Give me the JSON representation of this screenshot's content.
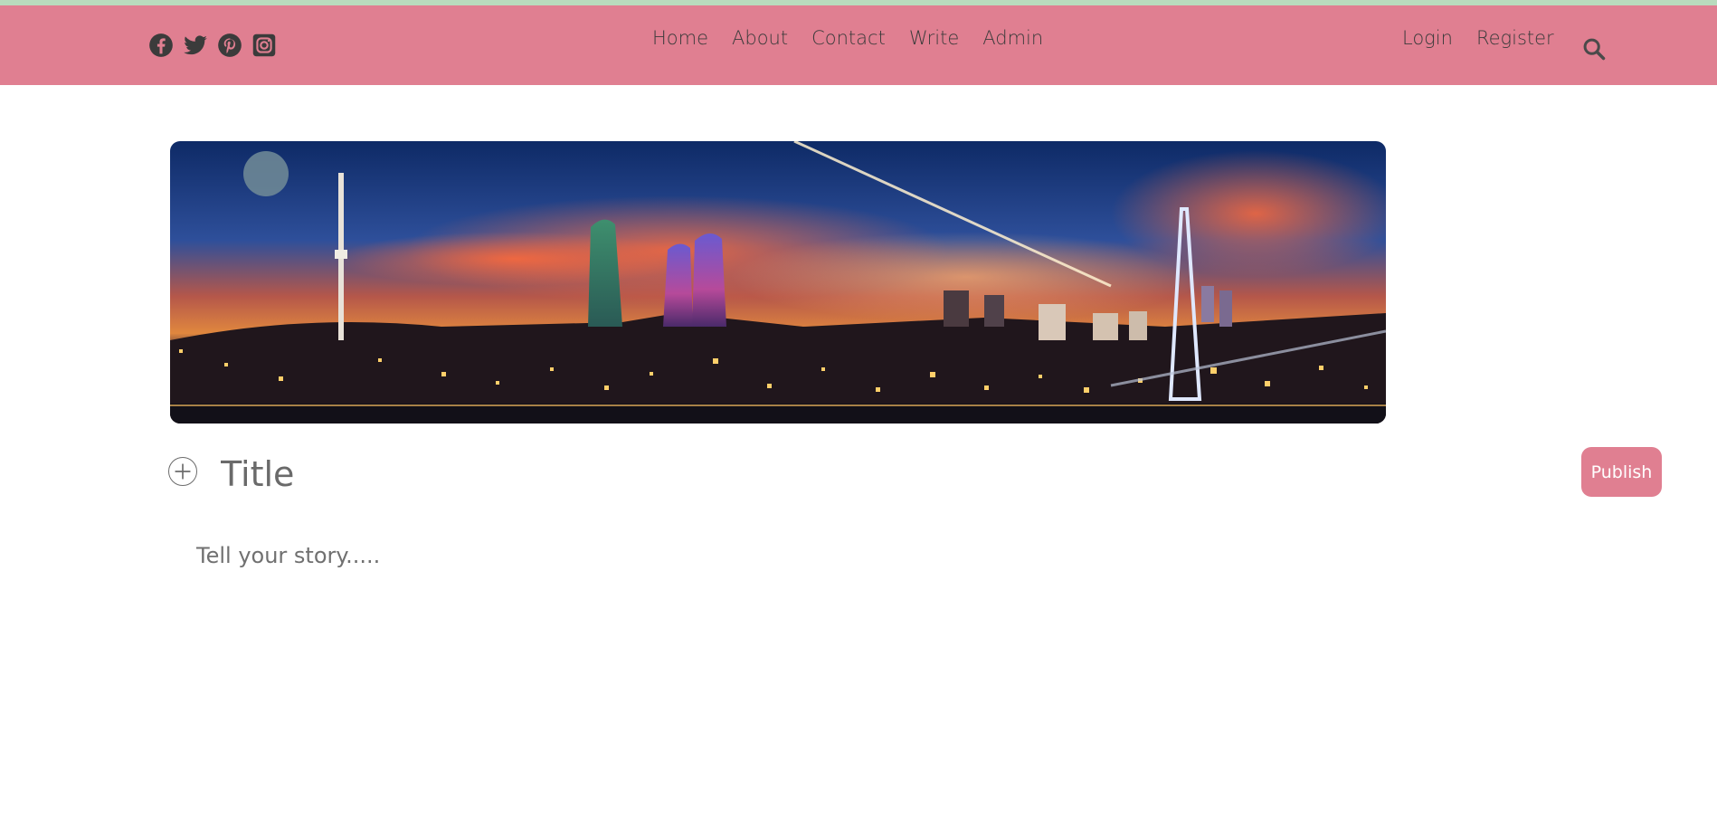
{
  "colors": {
    "navbar_bg": "#e07f91",
    "top_strip": "#b9dbbd",
    "icon_color": "#3b3b3b",
    "publish_bg": "#e07f91",
    "publish_text": "#ffffff"
  },
  "header": {
    "social_icons": [
      "facebook-icon",
      "twitter-icon",
      "pinterest-icon",
      "instagram-icon"
    ],
    "nav": [
      "Home",
      "About",
      "Contact",
      "Write",
      "Admin"
    ],
    "auth": {
      "login": "Login",
      "register": "Register"
    },
    "search_icon": "search-icon"
  },
  "hero": {
    "image": "night city skyline panorama with towers under a sunset sky"
  },
  "editor": {
    "add_icon": "plus-circle-icon",
    "title_placeholder": "Title",
    "story_placeholder": "Tell your story.....",
    "publish_label": "Publish"
  }
}
